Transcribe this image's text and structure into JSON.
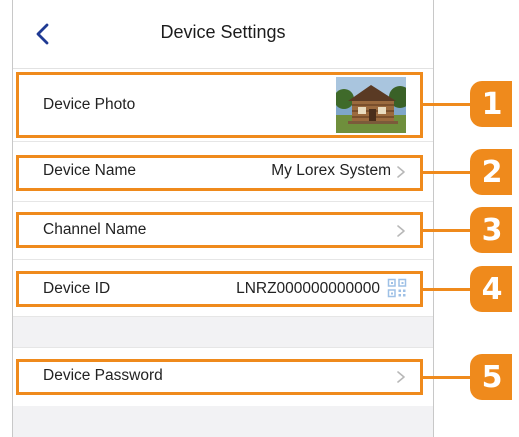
{
  "header": {
    "title": "Device Settings",
    "back_icon": "chevron-left-icon"
  },
  "rows": {
    "photo": {
      "label": "Device Photo"
    },
    "name": {
      "label": "Device Name",
      "value": "My Lorex System"
    },
    "channel": {
      "label": "Channel Name"
    },
    "id": {
      "label": "Device ID",
      "value": "LNRZ000000000000",
      "icon": "qr-code-icon"
    },
    "password": {
      "label": "Device Password"
    }
  },
  "callouts": [
    "1",
    "2",
    "3",
    "4",
    "5"
  ],
  "colors": {
    "accent": "#EF8A1C",
    "back_arrow": "#1F3A93",
    "chevron": "#B8B8B8",
    "section_gap": "#F2F2F4"
  }
}
